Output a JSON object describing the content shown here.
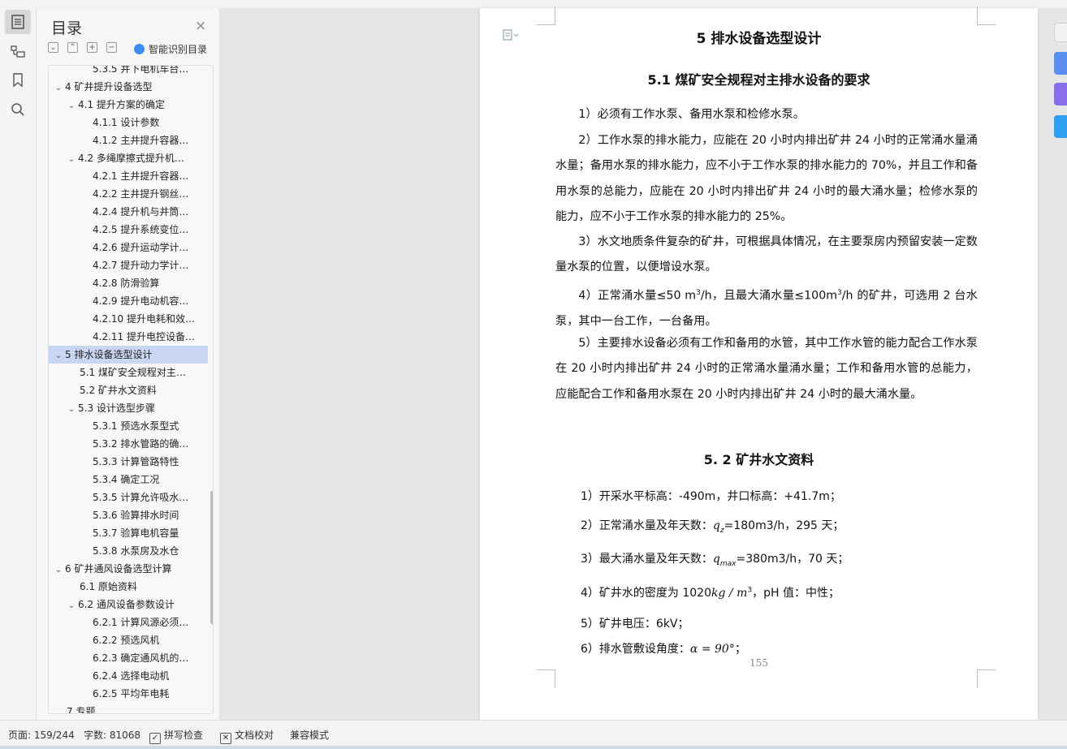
{
  "nav": {
    "title": "目录",
    "ai_label": "智能识别目录",
    "items": [
      {
        "label": "5.3.5 井下电机车台…",
        "level": 3
      },
      {
        "label": "4 矿井提升设备选型",
        "level": 1,
        "expanded": true
      },
      {
        "label": "4.1 提升方案的确定",
        "level": 2,
        "expanded": true
      },
      {
        "label": "4.1.1 设计参数",
        "level": 3
      },
      {
        "label": "4.1.2 主井提升容器…",
        "level": 3
      },
      {
        "label": "4.2 多绳摩擦式提升机…",
        "level": 2,
        "expanded": true
      },
      {
        "label": "4.2.1 主井提升容器…",
        "level": 3
      },
      {
        "label": "4.2.2 主井提升钢丝…",
        "level": 3
      },
      {
        "label": "4.2.4 提升机与井筒…",
        "level": 3
      },
      {
        "label": "4.2.5 提升系统变位…",
        "level": 3
      },
      {
        "label": "4.2.6 提升运动学计…",
        "level": 3
      },
      {
        "label": "4.2.7 提升动力学计…",
        "level": 3
      },
      {
        "label": "4.2.8 防滑验算",
        "level": 3
      },
      {
        "label": "4.2.9 提升电动机容…",
        "level": 3
      },
      {
        "label": "4.2.10 提升电耗和效…",
        "level": 3
      },
      {
        "label": "4.2.11 提升电控设备…",
        "level": 3
      },
      {
        "label": "5 排水设备选型设计",
        "level": 1,
        "expanded": true,
        "selected": true
      },
      {
        "label": "5.1 煤矿安全规程对主…",
        "level": 2
      },
      {
        "label": "5.2 矿井水文资料",
        "level": 2
      },
      {
        "label": "5.3 设计选型步骤",
        "level": 2,
        "expanded": true
      },
      {
        "label": "5.3.1 预选水泵型式",
        "level": 3
      },
      {
        "label": "5.3.2 排水管路的确…",
        "level": 3
      },
      {
        "label": "5.3.3 计算管路特性",
        "level": 3
      },
      {
        "label": "5.3.4 确定工况",
        "level": 3
      },
      {
        "label": "5.3.5 计算允许吸水…",
        "level": 3
      },
      {
        "label": "5.3.6 验算排水时间",
        "level": 3
      },
      {
        "label": "5.3.7 验算电机容量",
        "level": 3
      },
      {
        "label": "5.3.8 水泵房及水仓",
        "level": 3
      },
      {
        "label": "6 矿井通风设备选型计算",
        "level": 1,
        "expanded": true
      },
      {
        "label": "6.1 原始资料",
        "level": 2
      },
      {
        "label": "6.2 通风设备参数设计",
        "level": 2,
        "expanded": true
      },
      {
        "label": "6.2.1 计算风源必须…",
        "level": 3
      },
      {
        "label": "6.2.2 预选风机",
        "level": 3
      },
      {
        "label": "6.2.3 确定通风机的…",
        "level": 3
      },
      {
        "label": "6.2.4 选择电动机",
        "level": 3
      },
      {
        "label": "6.2.5  平均年电耗",
        "level": 3
      },
      {
        "label": "7 专题",
        "level": 1
      }
    ]
  },
  "doc": {
    "h1": "5 排水设备选型设计",
    "h2_1": "5.1  煤矿安全规程对主排水设备的要求",
    "p1": "1）必须有工作水泵、备用水泵和检修水泵。",
    "p2": "2）工作水泵的排水能力，应能在 20 小时内排出矿井 24 小时的正常涌水量涌水量；备用水泵的排水能力，应不小于工作水泵的排水能力的 70%，并且工作和备用水泵的总能力，应能在 20 小时内排出矿井 24 小时的最大涌水量；检修水泵的能力，应不小于工作水泵的排水能力的 25%。",
    "p3": "3）水文地质条件复杂的矿井，可根据具体情况，在主要泵房内预留安装一定数量水泵的位置，以便增设水泵。",
    "p4a": "4）正常涌水量≤50 m",
    "p4b": "3",
    "p4c": "/h，且最大涌水量≤100m",
    "p4d": "3",
    "p4e": "/h 的矿井，可选用 2 台水泵，其中一台工作，一台备用。",
    "p5": "5）主要排水设备必须有工作和备用的水管，其中工作水管的能力配合工作水泵在 20 小时内排出矿井 24 小时的正常涌水量涌水量；工作和备用水管的总能力，应能配合工作和备用水泵在 20 小时内排出矿井 24 小时的最大涌水量。",
    "h2_2": "5. 2 矿井水文资料",
    "i1": "1）开采水平标高：-490m，井口标高：+41.7m；",
    "i2a": "2）正常涌水量及年天数：",
    "i2q": "q",
    "i2s": "z",
    "i2b": "=180m3/h，295 天；",
    "i3a": "3）最大涌水量及年天数：",
    "i3q": "q",
    "i3s": "max",
    "i3b": "=380m3/h，70 天；",
    "i4a": "4）矿井水的密度为 1020",
    "i4u": "kg / m",
    "i4p": "3",
    "i4b": "，pH 值：中性；",
    "i5": "5）矿井电压：6kV；",
    "i6a": "6）排水管敷设角度：",
    "i6m": "α = 90°",
    "i6b": "；",
    "page_number": "155"
  },
  "status": {
    "page": "页面: 159/244",
    "words": "字数: 81068",
    "spell": "拼写检查",
    "proof": "文档校对",
    "compat": "兼容模式"
  },
  "colors": {
    "accent": "#3a8ef6",
    "selection": "#c9d6f2",
    "right_btn_1": "#5b8def",
    "right_btn_2": "#8a6de9",
    "right_btn_3": "#2f9ff0"
  }
}
